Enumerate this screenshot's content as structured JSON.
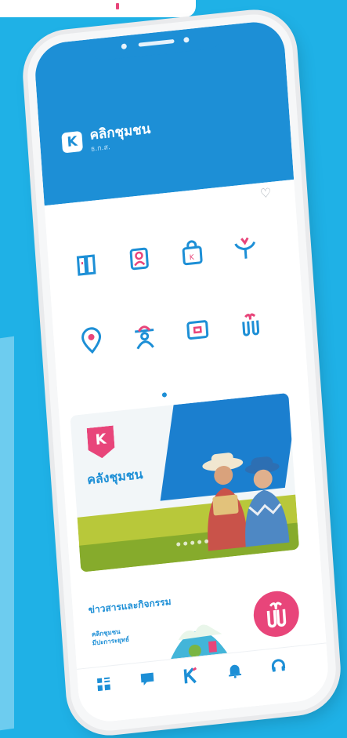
{
  "header": {
    "logo_letter": "K",
    "title": "คลิกชุมชน",
    "subtitle": "ธ.ก.ส."
  },
  "actions": {
    "favorite_icon": "heart-icon"
  },
  "menu": [
    {
      "icon": "book-icon",
      "label": ""
    },
    {
      "icon": "person-badge-icon",
      "label": ""
    },
    {
      "icon": "shop-bag-icon",
      "label": ""
    },
    {
      "icon": "sprout-icon",
      "label": ""
    },
    {
      "icon": "location-pin-icon",
      "label": ""
    },
    {
      "icon": "farmer-icon",
      "label": ""
    },
    {
      "icon": "map-icon",
      "label": ""
    },
    {
      "icon": "gift-icon",
      "label": ""
    }
  ],
  "banner": {
    "title": "คลังชุมชน",
    "description": ""
  },
  "news": {
    "heading": "ข่าวสารและกิจกรรม",
    "card_text": "คลิกชุมชน\nมีปะการะยุทธ์",
    "promo_text": ""
  },
  "bottom_nav": [
    {
      "icon": "grid-icon",
      "label": ""
    },
    {
      "icon": "chat-icon",
      "label": ""
    },
    {
      "icon": "home-logo-icon",
      "label": ""
    },
    {
      "icon": "bell-icon",
      "label": ""
    },
    {
      "icon": "headset-icon",
      "label": ""
    }
  ],
  "colors": {
    "background": "#1fb1e6",
    "brand_blue": "#1d8fd6",
    "accent_pink": "#e8457a"
  }
}
